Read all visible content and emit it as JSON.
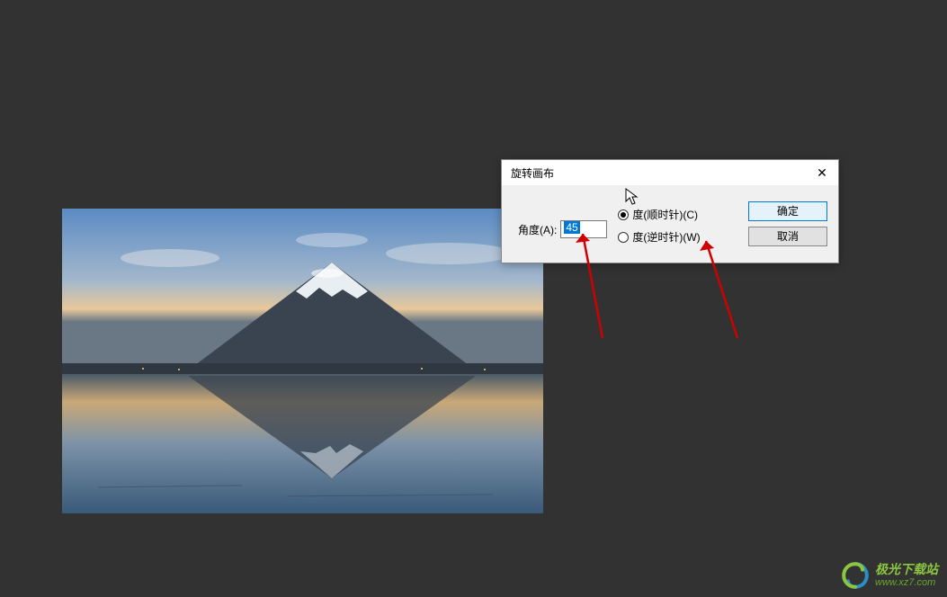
{
  "dialog": {
    "title": "旋转画布",
    "angle_label": "角度(A):",
    "angle_value": "45",
    "clockwise_label": "度(顺时针)(C)",
    "counterclockwise_label": "度(逆时针)(W)",
    "ok_label": "确定",
    "cancel_label": "取消"
  },
  "watermark": {
    "site_name": "极光下载站",
    "site_url": "www.xz7.com"
  }
}
